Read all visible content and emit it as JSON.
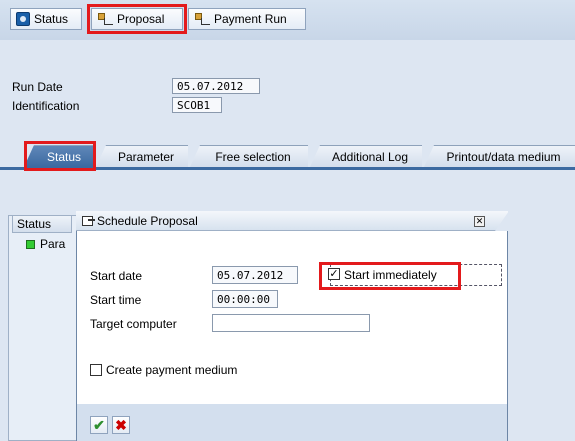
{
  "toolbar": {
    "status_label": "Status",
    "proposal_label": "Proposal",
    "payment_run_label": "Payment Run"
  },
  "header": {
    "run_date_label": "Run Date",
    "run_date_value": "05.07.2012",
    "identification_label": "Identification",
    "identification_value": "SCOB1"
  },
  "tabs": [
    {
      "label": "Status",
      "active": true
    },
    {
      "label": "Parameter",
      "active": false
    },
    {
      "label": "Free selection",
      "active": false
    },
    {
      "label": "Additional Log",
      "active": false
    },
    {
      "label": "Printout/data medium",
      "active": false
    }
  ],
  "status_pane": {
    "tab_label": "Status",
    "row_text": "Para"
  },
  "dialog": {
    "title": "Schedule Proposal",
    "start_date_label": "Start date",
    "start_date_value": "05.07.2012",
    "start_immediately_label": "Start immediately",
    "start_immediately_checked": true,
    "start_time_label": "Start time",
    "start_time_value": "00:00:00",
    "target_computer_label": "Target computer",
    "target_computer_value": "",
    "create_payment_medium_label": "Create payment medium",
    "create_payment_medium_checked": false
  },
  "colors": {
    "highlight": "#e31a1c",
    "active_tab": "#3c6aa1",
    "background": "#dde6f2",
    "status_ok": "#33cc33",
    "confirm": "#2f8f2f",
    "cancel": "#cc0000"
  },
  "icons": {
    "status": "status-icon",
    "proposal": "tree-icon",
    "payment_run": "tree-icon",
    "dialog": "window-icon",
    "close": "close-icon",
    "confirm": "checkmark-icon",
    "cancel": "cross-icon"
  }
}
